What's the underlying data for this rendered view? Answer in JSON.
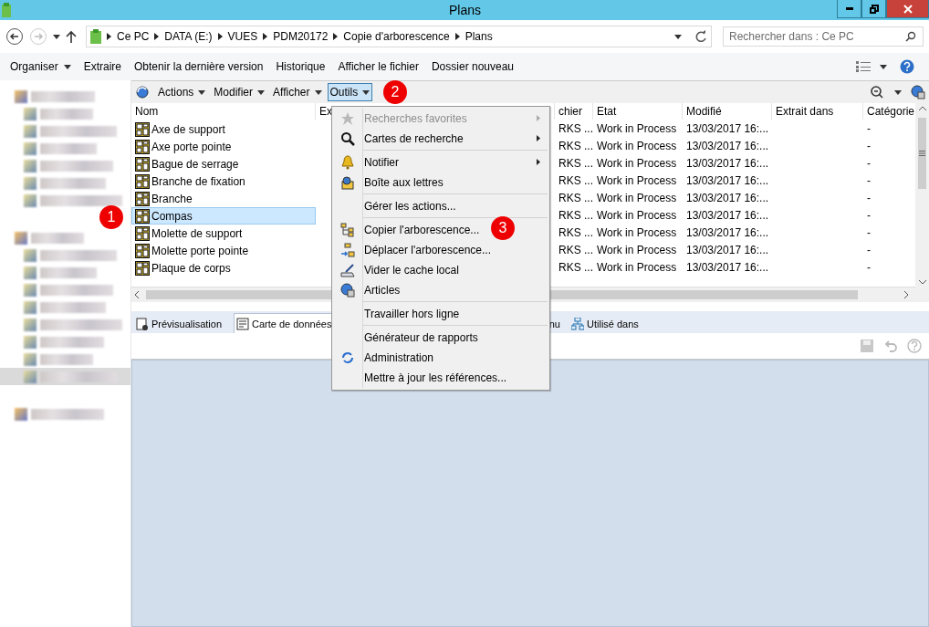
{
  "window": {
    "title": "Plans"
  },
  "address_bar": {
    "path": [
      "Ce PC",
      "DATA (E:)",
      "VUES",
      "PDM20172",
      "Copie d'arborescence",
      "Plans"
    ]
  },
  "search": {
    "placeholder": "Rechercher dans : Ce PC"
  },
  "command_bar": [
    {
      "label": "Organiser",
      "dropdown": true
    },
    {
      "label": "Extraire",
      "dropdown": false
    },
    {
      "label": "Obtenir la dernière version",
      "dropdown": false
    },
    {
      "label": "Historique",
      "dropdown": false
    },
    {
      "label": "Afficher le fichier",
      "dropdown": false
    },
    {
      "label": "Dossier nouveau",
      "dropdown": false
    }
  ],
  "sidebar": {
    "items": [
      {
        "kind": "header",
        "selected": false
      },
      {
        "kind": "child",
        "selected": false
      },
      {
        "kind": "child",
        "selected": false
      },
      {
        "kind": "child",
        "selected": false
      },
      {
        "kind": "child",
        "selected": false
      },
      {
        "kind": "child",
        "selected": false
      },
      {
        "kind": "child",
        "selected": false
      },
      {
        "kind": "gap",
        "selected": false
      },
      {
        "kind": "header",
        "selected": false
      },
      {
        "kind": "child",
        "selected": false
      },
      {
        "kind": "child",
        "selected": false
      },
      {
        "kind": "child",
        "selected": false
      },
      {
        "kind": "child",
        "selected": false
      },
      {
        "kind": "child",
        "selected": false
      },
      {
        "kind": "child",
        "selected": false
      },
      {
        "kind": "child",
        "selected": false
      },
      {
        "kind": "child",
        "selected": true
      },
      {
        "kind": "gap",
        "selected": false
      },
      {
        "kind": "header",
        "selected": false
      }
    ]
  },
  "vault_toolbar": [
    {
      "label": "Actions",
      "selected": false
    },
    {
      "label": "Modifier",
      "selected": false
    },
    {
      "label": "Afficher",
      "selected": false
    },
    {
      "label": "Outils",
      "selected": true
    }
  ],
  "table": {
    "columns": [
      "Nom",
      "Ex",
      "chier",
      "Etat",
      "Modifié",
      "Extrait dans",
      "Catégorie"
    ],
    "rows": [
      {
        "name": "Axe de support",
        "file": "RKS ...",
        "state": "Work in Process",
        "modified": "13/03/2017 16:...",
        "category": "-",
        "selected": false
      },
      {
        "name": "Axe porte pointe",
        "file": "RKS ...",
        "state": "Work in Process",
        "modified": "13/03/2017 16:...",
        "category": "-",
        "selected": false
      },
      {
        "name": "Bague de serrage",
        "file": "RKS ...",
        "state": "Work in Process",
        "modified": "13/03/2017 16:...",
        "category": "-",
        "selected": false
      },
      {
        "name": "Branche de fixation",
        "file": "RKS ...",
        "state": "Work in Process",
        "modified": "13/03/2017 16:...",
        "category": "-",
        "selected": false
      },
      {
        "name": "Branche",
        "file": "RKS ...",
        "state": "Work in Process",
        "modified": "13/03/2017 16:...",
        "category": "-",
        "selected": false
      },
      {
        "name": "Compas",
        "file": "RKS ...",
        "state": "Work in Process",
        "modified": "13/03/2017 16:...",
        "category": "-",
        "selected": true
      },
      {
        "name": "Molette de support",
        "file": "RKS ...",
        "state": "Work in Process",
        "modified": "13/03/2017 16:...",
        "category": "-",
        "selected": false
      },
      {
        "name": "Molette porte pointe",
        "file": "RKS ...",
        "state": "Work in Process",
        "modified": "13/03/2017 16:...",
        "category": "-",
        "selected": false
      },
      {
        "name": "Plaque de corps",
        "file": "RKS ...",
        "state": "Work in Process",
        "modified": "13/03/2017 16:...",
        "category": "-",
        "selected": false
      }
    ]
  },
  "menu": {
    "groups": [
      [
        {
          "label": "Recherches favorites",
          "disabled": true,
          "submenu": true
        },
        {
          "label": "Cartes de recherche",
          "disabled": false,
          "submenu": true
        }
      ],
      [
        {
          "label": "Notifier",
          "disabled": false,
          "submenu": true
        },
        {
          "label": "Boîte aux lettres",
          "disabled": false,
          "submenu": false
        }
      ],
      [
        {
          "label": "Gérer les actions...",
          "disabled": false,
          "submenu": false
        }
      ],
      [
        {
          "label": "Copier l'arborescence...",
          "disabled": false,
          "submenu": false
        },
        {
          "label": "Déplacer l'arborescence...",
          "disabled": false,
          "submenu": false
        },
        {
          "label": "Vider le cache local",
          "disabled": false,
          "submenu": false
        },
        {
          "label": "Articles",
          "disabled": false,
          "submenu": false
        }
      ],
      [
        {
          "label": "Travailler hors ligne",
          "disabled": false,
          "submenu": false
        }
      ],
      [
        {
          "label": "Générateur de rapports",
          "disabled": false,
          "submenu": false
        },
        {
          "label": "Administration",
          "disabled": false,
          "submenu": false
        },
        {
          "label": "Mettre à jour les références...",
          "disabled": false,
          "submenu": false
        }
      ]
    ]
  },
  "bottom_tabs": [
    {
      "label": "Prévisualisation",
      "selected": false,
      "kind": "full"
    },
    {
      "label": "Carte de données",
      "selected": true,
      "kind": "full"
    },
    {
      "label": "nu",
      "selected": false,
      "kind": "cut"
    },
    {
      "label": "Utilisé dans",
      "selected": false,
      "kind": "full"
    }
  ],
  "annotations": [
    "1",
    "2",
    "3"
  ]
}
